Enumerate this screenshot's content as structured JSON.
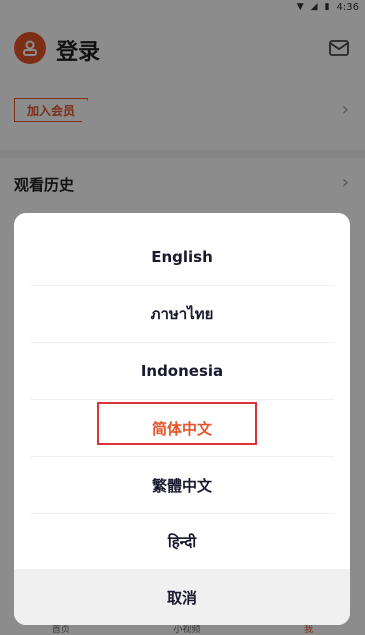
{
  "status_bar": {
    "time": "4:36",
    "icons": [
      "wifi-icon",
      "signal-icon",
      "battery-icon"
    ]
  },
  "header": {
    "title": "登录",
    "avatar_icon": "user-avatar-icon",
    "mail_icon": "mail-icon"
  },
  "vip": {
    "label": "加入会员"
  },
  "history": {
    "label": "观看历史"
  },
  "tab_bar": {
    "items": [
      "首页",
      "小视频",
      "我"
    ]
  },
  "language_sheet": {
    "options": [
      "English",
      "ภาษาไทย",
      "Indonesia",
      "简体中文",
      "繁體中文",
      "हिन्दी"
    ],
    "selected": "简体中文",
    "cancel_label": "取消"
  },
  "colors": {
    "accent": "#e2552a",
    "selection_border": "#d9343a",
    "overlay": "rgba(0,0,0,0.45)"
  }
}
